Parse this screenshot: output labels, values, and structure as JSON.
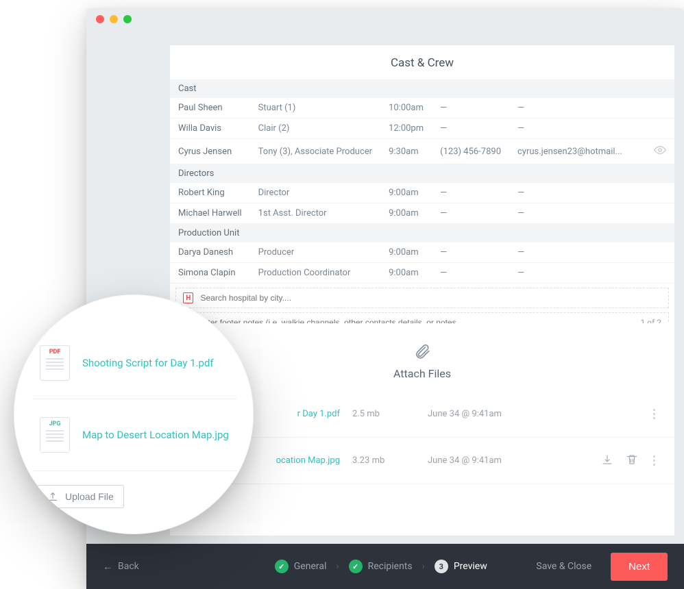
{
  "section_title": "Cast & Crew",
  "groups": [
    {
      "name": "Cast",
      "rows": [
        {
          "name": "Paul Sheen",
          "role": "Stuart (1)",
          "time": "10:00am",
          "phone": "—",
          "email": "—"
        },
        {
          "name": "Willa Davis",
          "role": "Clair (2)",
          "time": "12:00pm",
          "phone": "—",
          "email": "—"
        },
        {
          "name": "Cyrus Jensen",
          "role": "Tony (3), Associate Producer",
          "time": "9:30am",
          "phone": "(123) 456-7890",
          "email": "cyrus.jensen23@hotmail...",
          "eye": true
        }
      ]
    },
    {
      "name": "Directors",
      "rows": [
        {
          "name": "Robert King",
          "role": "Director",
          "time": "9:00am",
          "phone": "—",
          "email": "—"
        },
        {
          "name": "Michael Harwell",
          "role": "1st Asst. Director",
          "time": "9:00am",
          "phone": "—",
          "email": "—"
        }
      ]
    },
    {
      "name": "Production Unit",
      "rows": [
        {
          "name": "Darya Danesh",
          "role": "Producer",
          "time": "9:00am",
          "phone": "—",
          "email": "—"
        },
        {
          "name": "Simona Clapin",
          "role": "Production Coordinator",
          "time": "9:00am",
          "phone": "—",
          "email": "—"
        }
      ]
    }
  ],
  "hospital_placeholder": "Search hospital by city....",
  "footer_placeholder": "Enter footer notes (i.e. walkie channels, other contacts details, or notes...",
  "page_indicator": "1 of 2",
  "attach": {
    "title": "Attach Files",
    "files": [
      {
        "name": "r Day 1.pdf",
        "size": "2.5 mb",
        "date": "June 34 @ 9:41am"
      },
      {
        "name": "ocation Map.jpg",
        "size": "3.23 mb",
        "date": "June 34 @ 9:41am",
        "actions": true
      }
    ]
  },
  "magnifier": {
    "files": [
      {
        "ext": "PDF",
        "type": "pdf",
        "name": "Shooting Script for Day 1.pdf"
      },
      {
        "ext": "JPG",
        "type": "jpg",
        "name": "Map to Desert Location Map.jpg"
      }
    ],
    "upload_label": "Upload File"
  },
  "bottombar": {
    "back": "Back",
    "steps": [
      {
        "label": "General",
        "state": "done"
      },
      {
        "label": "Recipients",
        "state": "done"
      },
      {
        "label": "Preview",
        "state": "active",
        "num": "3"
      }
    ],
    "save_close": "Save & Close",
    "next": "Next"
  }
}
